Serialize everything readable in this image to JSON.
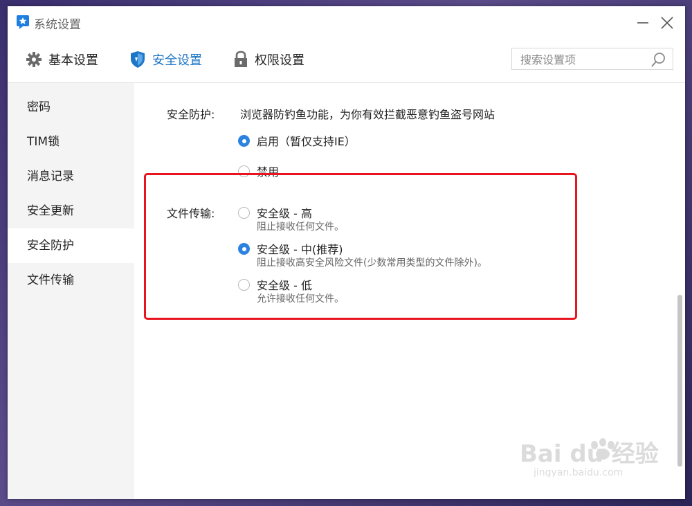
{
  "window": {
    "title": "系统设置"
  },
  "tabs": [
    {
      "label": "基本设置",
      "icon": "gear-icon"
    },
    {
      "label": "安全设置",
      "icon": "shield-icon",
      "active": true
    },
    {
      "label": "权限设置",
      "icon": "lock-icon"
    }
  ],
  "search": {
    "placeholder": "搜索设置项",
    "value": ""
  },
  "sidebar": {
    "items": [
      {
        "label": "密码"
      },
      {
        "label": "TIM锁"
      },
      {
        "label": "消息记录"
      },
      {
        "label": "安全更新"
      },
      {
        "label": "安全防护",
        "active": true
      },
      {
        "label": "文件传输"
      }
    ]
  },
  "security_protection": {
    "label": "安全防护:",
    "description": "浏览器防钓鱼功能，为你有效拦截恶意钓鱼盗号网站",
    "options": [
      {
        "label": "启用（暂仅支持IE）",
        "checked": true
      },
      {
        "label": "禁用",
        "checked": false
      }
    ]
  },
  "file_transfer": {
    "label": "文件传输:",
    "options": [
      {
        "label": "安全级 - 高",
        "sub": "阻止接收任何文件。",
        "checked": false
      },
      {
        "label": "安全级 - 中(推荐)",
        "sub": "阻止接收高安全风险文件(少数常用类型的文件除外)。",
        "checked": true
      },
      {
        "label": "安全级 - 低",
        "sub": "允许接收任何文件。",
        "checked": false
      }
    ]
  },
  "watermark": {
    "brand": "Bai du 经验",
    "url": "jingyan.baidu.com"
  },
  "colors": {
    "accent": "#2b82e0",
    "highlight_border": "#e8141e",
    "active_tab": "#1d75c7"
  }
}
